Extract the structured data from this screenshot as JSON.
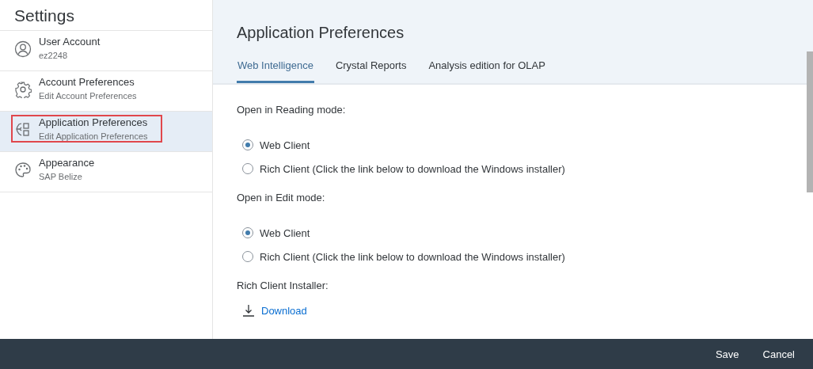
{
  "sidebar": {
    "title": "Settings",
    "items": [
      {
        "kind": "user",
        "label": "User Account",
        "sublabel": "ez2248",
        "selected": false,
        "highlighted": false
      },
      {
        "kind": "gear",
        "label": "Account Preferences",
        "sublabel": "Edit Account Preferences",
        "selected": false,
        "highlighted": false
      },
      {
        "kind": "apps",
        "label": "Application Preferences",
        "sublabel": "Edit Application Preferences",
        "selected": true,
        "highlighted": true
      },
      {
        "kind": "palette",
        "label": "Appearance",
        "sublabel": "SAP Belize",
        "selected": false,
        "highlighted": false
      }
    ]
  },
  "page": {
    "title": "Application Preferences",
    "tabs": [
      {
        "label": "Web Intelligence",
        "selected": true
      },
      {
        "label": "Crystal Reports",
        "selected": false
      },
      {
        "label": "Analysis edition for OLAP",
        "selected": false
      }
    ],
    "groups": [
      {
        "label": "Open in Reading mode:",
        "options": [
          {
            "label": "Web Client",
            "selected": true
          },
          {
            "label": "Rich Client (Click the link below to download the Windows installer)",
            "selected": false
          }
        ]
      },
      {
        "label": "Open in Edit mode:",
        "options": [
          {
            "label": "Web Client",
            "selected": true
          },
          {
            "label": "Rich Client (Click the link below to download the Windows installer)",
            "selected": false
          }
        ]
      }
    ],
    "installer": {
      "label": "Rich Client Installer:",
      "link": "Download"
    }
  },
  "footer": {
    "buttons": [
      "Save",
      "Cancel"
    ]
  }
}
